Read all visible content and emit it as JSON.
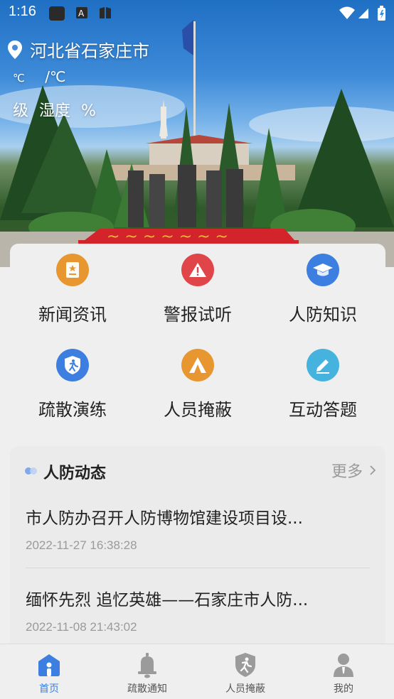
{
  "status_bar": {
    "time": "1:16"
  },
  "location": {
    "city": "河北省石家庄市"
  },
  "weather": {
    "temp_unit_small": "℃",
    "temp_range": "/℃",
    "wind_level": "级",
    "humidity_label": "湿度",
    "humidity_unit": "%"
  },
  "grid": {
    "items": [
      {
        "label": "新闻资讯",
        "icon": "news-icon",
        "color": "#e8962f"
      },
      {
        "label": "警报试听",
        "icon": "alarm-icon",
        "color": "#e0454a"
      },
      {
        "label": "人防知识",
        "icon": "graduation-cap-icon",
        "color": "#3d7fe0"
      },
      {
        "label": "疏散演练",
        "icon": "evacuation-shield-icon",
        "color": "#3d7fe0"
      },
      {
        "label": "人员掩蔽",
        "icon": "shelter-tent-icon",
        "color": "#e8962f"
      },
      {
        "label": "互动答题",
        "icon": "pencil-icon",
        "color": "#45b3dd"
      }
    ]
  },
  "news": {
    "section_title": "人防动态",
    "more_label": "更多",
    "items": [
      {
        "title": "市人防办召开人防博物馆建设项目设...",
        "date": "2022-11-27 16:38:28"
      },
      {
        "title": "缅怀先烈 追忆英雄——石家庄市人防...",
        "date": "2022-11-08 21:43:02"
      }
    ]
  },
  "bottom_nav": {
    "tabs": [
      {
        "label": "首页",
        "icon": "home-icon",
        "active": true
      },
      {
        "label": "疏散通知",
        "icon": "bell-icon",
        "active": false
      },
      {
        "label": "人员掩蔽",
        "icon": "shelter-shield-icon",
        "active": false
      },
      {
        "label": "我的",
        "icon": "user-icon",
        "active": false
      }
    ]
  },
  "colors": {
    "accent": "#3d7fe0",
    "orange": "#e8962f",
    "red": "#e0454a",
    "cyan": "#45b3dd"
  }
}
